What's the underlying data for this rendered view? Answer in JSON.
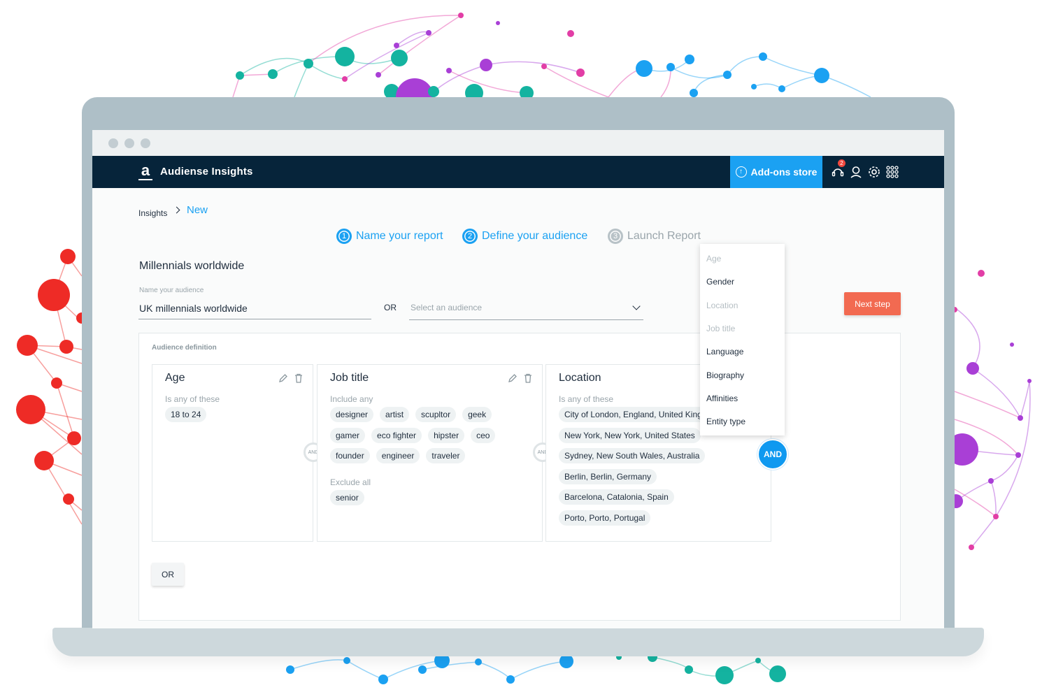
{
  "app": {
    "name": "Audiense Insights",
    "logo_glyph": "a"
  },
  "header": {
    "addons_label": "Add-ons store",
    "addons_icon": "upload-circle-icon",
    "notification_count": "2",
    "icons": [
      "support-icon",
      "user-icon",
      "gear-icon",
      "apps-grid-icon"
    ]
  },
  "breadcrumb": {
    "root": "Insights",
    "current": "New"
  },
  "steps": [
    {
      "num": "1",
      "label": "Name your report",
      "state": "active"
    },
    {
      "num": "2",
      "label": "Define your audience",
      "state": "active"
    },
    {
      "num": "3",
      "label": "Launch Report",
      "state": "inactive"
    }
  ],
  "report": {
    "title": "Millennials worldwide"
  },
  "audience": {
    "field_label": "Name your audience",
    "name_value": "UK millennials worldwide",
    "or_label": "OR",
    "select_placeholder": "Select an audience"
  },
  "next_button": "Next step",
  "definition": {
    "title": "Audience definition",
    "and_small": "AND",
    "and_big": "AND",
    "or_button": "OR",
    "cards": {
      "age": {
        "title": "Age",
        "sub": "Is any of these",
        "values": [
          "18 to 24"
        ]
      },
      "job": {
        "title": "Job title",
        "include_label": "Include any",
        "include": [
          "designer",
          "artist",
          "scupltor",
          "geek",
          "gamer",
          "eco fighter",
          "hipster",
          "ceo",
          "founder",
          "engineer",
          "traveler"
        ],
        "exclude_label": "Exclude all",
        "exclude": [
          "senior"
        ]
      },
      "location": {
        "title": "Location",
        "sub": "Is any of these",
        "values": [
          "City of London, England, United Kingdom",
          "New York, New York, United States",
          "Sydney, New South Wales, Australia",
          "Berlin, Berlin, Germany",
          "Barcelona, Catalonia, Spain",
          "Porto, Porto, Portugal"
        ]
      }
    }
  },
  "dropdown": [
    {
      "label": "Age",
      "enabled": false
    },
    {
      "label": "Gender",
      "enabled": true
    },
    {
      "label": "Location",
      "enabled": false
    },
    {
      "label": "Job title",
      "enabled": false
    },
    {
      "label": "Language",
      "enabled": true
    },
    {
      "label": "Biography",
      "enabled": true
    },
    {
      "label": "Affinities",
      "enabled": true
    },
    {
      "label": "Entity type",
      "enabled": true
    }
  ],
  "colors": {
    "navy": "#06243a",
    "accent": "#1ba1f2",
    "cta": "#f26a51",
    "teal": "#14b3a0",
    "magenta": "#e23ea6",
    "purple": "#a93fd6",
    "red": "#ee2b26"
  }
}
